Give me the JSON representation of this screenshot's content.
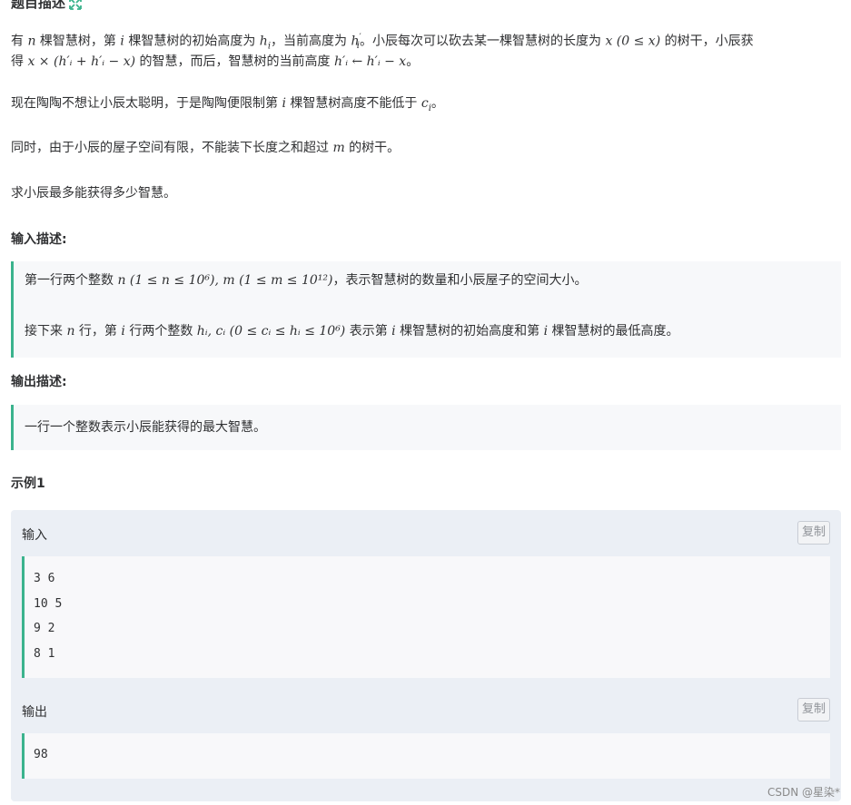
{
  "problem": {
    "title": "题目描述",
    "title_icon": "expand-icon",
    "statement": {
      "l1_a": "有 ",
      "l1_n": "n",
      "l1_b": " 棵智慧树，第 ",
      "l1_i": "i",
      "l1_c": " 棵智慧树的初始高度为 ",
      "l1_h": "h",
      "l1_hsub": "i",
      "l1_d": "，当前高度为 ",
      "l1_hp": "h",
      "l1_hpsup": "′",
      "l1_hpsub": "i",
      "l1_e": "。小辰每次可以砍去某一棵智慧树的长度为 ",
      "l1_x": "x",
      "l1_cond": "(0 ≤ x)",
      "l1_f": " 的树干，小辰获",
      "l2_a": "得 ",
      "l2_expr": "x × (h′ᵢ + h′ᵢ − x)",
      "l2_b": " 的智慧，而后，智慧树的当前高度 ",
      "l2_assign": "h′ᵢ ← h′ᵢ − x",
      "l2_c": "。",
      "p2_a": "现在陶陶不想让小辰太聪明，于是陶陶便限制第 ",
      "p2_i": "i",
      "p2_b": " 棵智慧树高度不能低于 ",
      "p2_c": "c",
      "p2_csub": "i",
      "p2_d": "。",
      "p3_a": "同时，由于小辰的屋子空间有限，不能装下长度之和超过 ",
      "p3_m": "m",
      "p3_b": " 的树干。",
      "p4": "求小辰最多能获得多少智慧。"
    },
    "input_desc": {
      "heading": "输入描述:",
      "line1_a": "第一行两个整数 ",
      "line1_math": "n (1 ≤ n ≤ 10⁶), m (1 ≤ m ≤ 10¹²)",
      "line1_b": "，表示智慧树的数量和小辰屋子的空间大小。",
      "line2_a": "接下来 ",
      "line2_n": "n",
      "line2_b": " 行，第 ",
      "line2_i": "i",
      "line2_c": " 行两个整数 ",
      "line2_math": "hᵢ, cᵢ (0 ≤ cᵢ ≤ hᵢ ≤ 10⁶)",
      "line2_d": " 表示第 ",
      "line2_i2": "i",
      "line2_e": " 棵智慧树的初始高度和第 ",
      "line2_i3": "i",
      "line2_f": " 棵智慧树的最低高度。"
    },
    "output_desc": {
      "heading": "输出描述:",
      "line1": "一行一个整数表示小辰能获得的最大智慧。"
    },
    "example": {
      "heading": "示例1",
      "input_label": "输入",
      "copy_label": "复制",
      "input_lines": [
        "3 6",
        "10 5",
        "9 2",
        "8 1"
      ],
      "output_label": "输出",
      "output_lines": [
        "98"
      ]
    }
  },
  "watermark": "CSDN @星染*",
  "colors": {
    "accent": "#3bb38d",
    "text": "#303133",
    "panel": "#ebeff5"
  }
}
